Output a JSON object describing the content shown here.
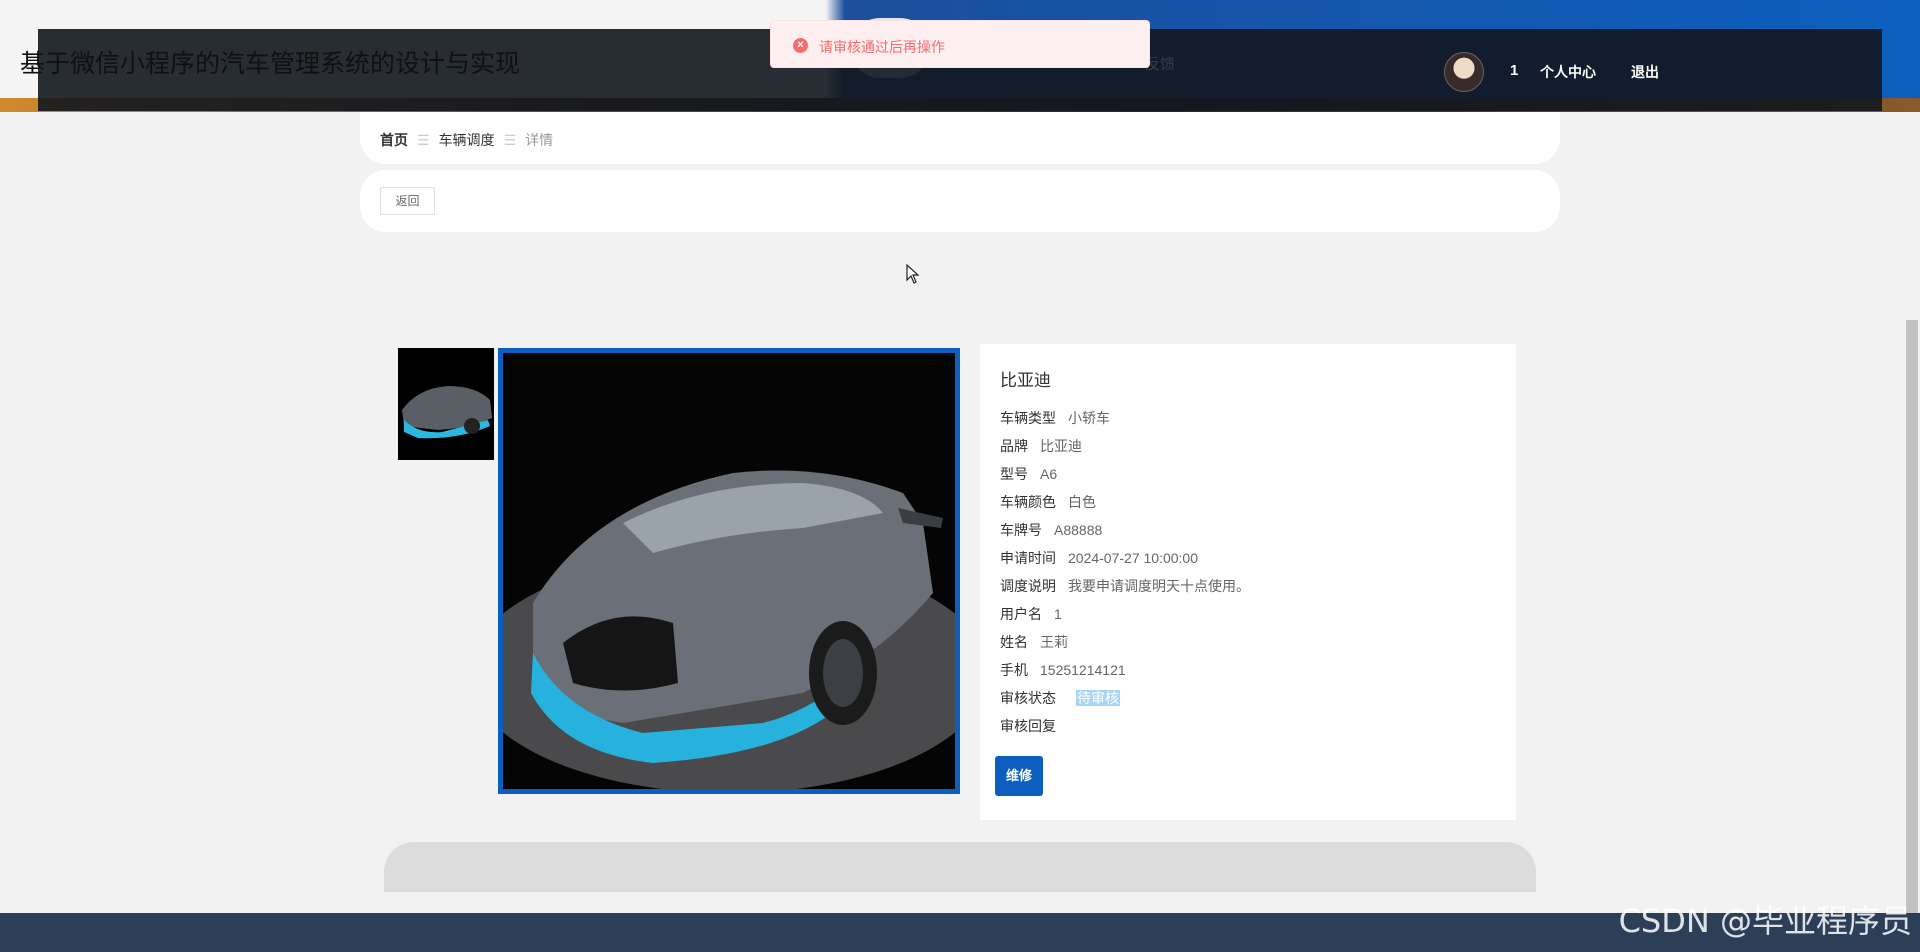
{
  "header": {
    "site_title": "基于微信小程序的汽车管理系统的设计与实现",
    "ghost_menu": "反馈",
    "user_id": "1",
    "profile_label": "个人中心",
    "logout_label": "退出"
  },
  "toast": {
    "message": "请审核通过后再操作",
    "icon": "error-circle-icon",
    "color": "#f56c6c"
  },
  "breadcrumb": {
    "home": "首页",
    "section": "车辆调度",
    "current": "详情",
    "separator": "☰"
  },
  "back_label": "返回",
  "detail": {
    "title": "比亚迪",
    "fields": [
      {
        "label": "车辆类型",
        "value": "小轿车"
      },
      {
        "label": "品牌",
        "value": "比亚迪"
      },
      {
        "label": "型号",
        "value": "A6"
      },
      {
        "label": "车辆颜色",
        "value": "白色"
      },
      {
        "label": "车牌号",
        "value": "A88888"
      },
      {
        "label": "申请时间",
        "value": "2024-07-27 10:00:00"
      },
      {
        "label": "调度说明",
        "value": "我要申请调度明天十点使用。"
      },
      {
        "label": "用户名",
        "value": "1"
      },
      {
        "label": "姓名",
        "value": "王莉"
      },
      {
        "label": "手机",
        "value": "15251214121"
      },
      {
        "label": "审核状态",
        "value": "待审核"
      },
      {
        "label": "审核回复",
        "value": ""
      }
    ],
    "repair_label": "维修"
  },
  "watermark": "CSDN @毕业程序员",
  "colors": {
    "accent": "#0d5fbf",
    "footer": "#2d3e57",
    "topbar": "#12161e"
  }
}
